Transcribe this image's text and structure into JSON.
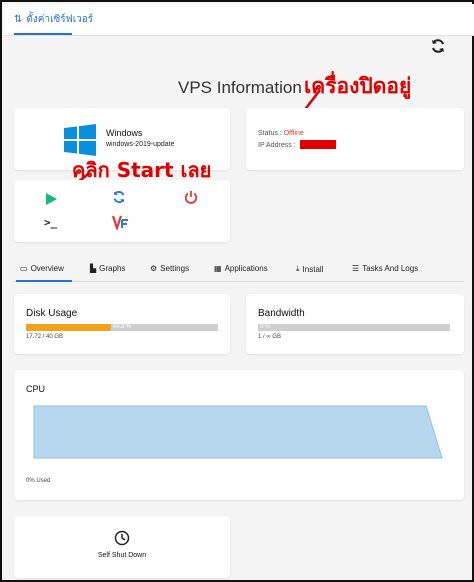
{
  "header": {
    "tab_label": "ตั้งค่าเซิร์ฟเวอร์"
  },
  "page": {
    "title": "VPS Information"
  },
  "annotations": {
    "machine_off": "เครื่องปิดอยู่",
    "click_start": "คลิก Start เลย",
    "color": "#e10000"
  },
  "os": {
    "name": "Windows",
    "version": "windows-2019-update",
    "icon": "windows-logo-icon"
  },
  "status": {
    "status_label": "Status :",
    "status_value": "Offline",
    "ip_label": "IP Address :",
    "status_color": "#e53935"
  },
  "power": {
    "start_icon": "play-icon",
    "restart_icon": "refresh-icon",
    "stop_icon": "power-icon",
    "console_icon": "terminal-icon",
    "vnc_icon": "vnc-icon",
    "console_glyph": ">_"
  },
  "tabs": [
    {
      "label": "Overview",
      "icon": "desktop-icon"
    },
    {
      "label": "Graphs",
      "icon": "bar-chart-icon"
    },
    {
      "label": "Settings",
      "icon": "gear-icon"
    },
    {
      "label": "Applications",
      "icon": "apps-icon"
    },
    {
      "label": "Install",
      "icon": "download-icon"
    },
    {
      "label": "Tasks And Logs",
      "icon": "list-icon"
    }
  ],
  "disk": {
    "title": "Disk Usage",
    "percent_label": "44.3 %",
    "percent": 44.3,
    "detail": "17.72 / 40 GB",
    "fill_color": "#f3a21a"
  },
  "bandwidth": {
    "title": "Bandwidth",
    "percent_label": "0 %",
    "percent": 0,
    "detail": "1 / ∞ GB"
  },
  "cpu": {
    "title": "CPU",
    "used": "0% Used",
    "fill_color": "#b7d7ef"
  },
  "shutdown": {
    "label": "Self Shut Down",
    "icon": "clock-icon"
  },
  "accent_color": "#2a6fd1"
}
